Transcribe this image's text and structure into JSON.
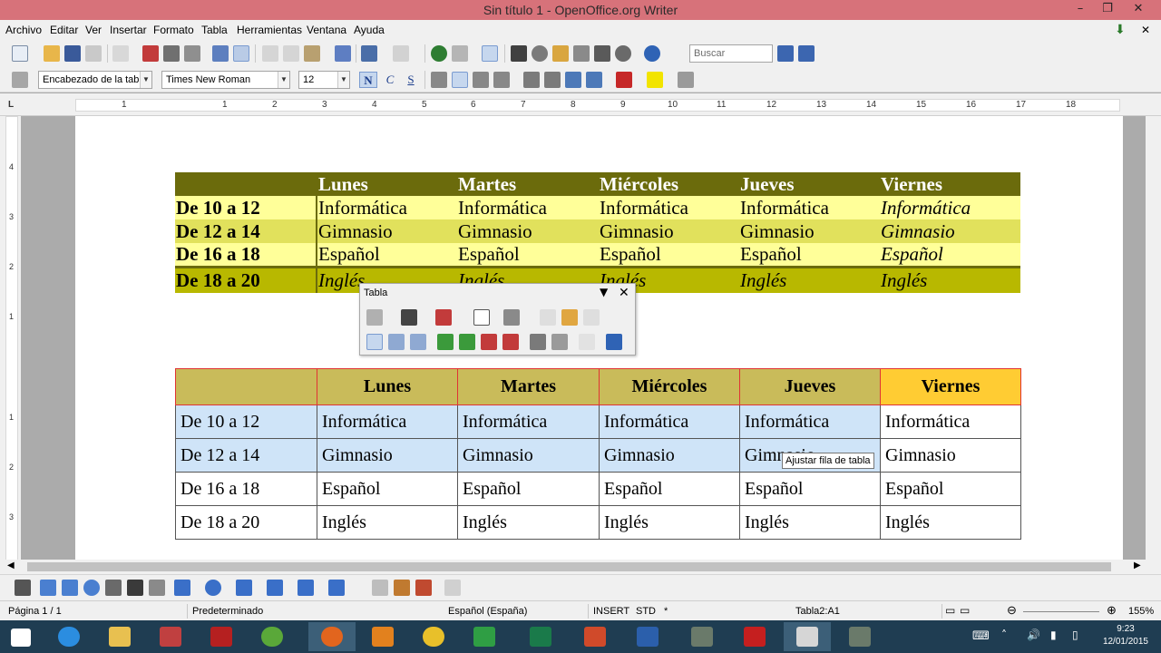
{
  "window": {
    "title": "Sin título 1 - OpenOffice.org Writer"
  },
  "menu": [
    "Archivo",
    "Editar",
    "Ver",
    "Insertar",
    "Formato",
    "Tabla",
    "Herramientas",
    "Ventana",
    "Ayuda"
  ],
  "toolbar": {
    "search_placeholder": "Buscar",
    "paragraph_style": "Encabezado de la tabl",
    "font_name": "Times New Roman",
    "font_size": "12",
    "bold_label": "N",
    "italic_label": "C",
    "underline_label": "S"
  },
  "ruler": {
    "h": [
      "1",
      "1",
      "2",
      "3",
      "4",
      "5",
      "6",
      "7",
      "8",
      "9",
      "10",
      "11",
      "12",
      "13",
      "14",
      "15",
      "16",
      "17",
      "18"
    ],
    "v": [
      "4",
      "3",
      "2",
      "1",
      "1",
      "2",
      "3"
    ]
  },
  "table1": {
    "header": [
      "",
      "Lunes",
      "Martes",
      "Miércoles",
      "Jueves",
      "Viernes"
    ],
    "rows": [
      [
        "De 10 a 12",
        "Informática",
        "Informática",
        "Informática",
        "Informática",
        "Informática"
      ],
      [
        "De 12 a 14",
        "Gimnasio",
        "Gimnasio",
        "Gimnasio",
        "Gimnasio",
        "Gimnasio"
      ],
      [
        "De 16 a 18",
        "Español",
        "Español",
        "Español",
        "Español",
        "Español"
      ],
      [
        "De 18 a 20",
        "Inglés",
        "Inglés",
        "Inglés",
        "Inglés",
        "Inglés"
      ]
    ]
  },
  "table2": {
    "header": [
      "",
      "Lunes",
      "Martes",
      "Miércoles",
      "Jueves",
      "Viernes"
    ],
    "rows": [
      [
        "De 10 a 12",
        "Informática",
        "Informática",
        "Informática",
        "Informática",
        "Informática"
      ],
      [
        "De 12 a 14",
        "Gimnasio",
        "Gimnasio",
        "Gimnasio",
        "Gimnasio",
        "Gimnasio"
      ],
      [
        "De 16 a 18",
        "Español",
        "Español",
        "Español",
        "Español",
        "Español"
      ],
      [
        "De 18 a 20",
        "Inglés",
        "Inglés",
        "Inglés",
        "Inglés",
        "Inglés"
      ]
    ]
  },
  "float_toolbar": {
    "title": "Tabla"
  },
  "tooltip": "Ajustar fila de tabla",
  "status": {
    "page": "Página 1 / 1",
    "style": "Predeterminado",
    "language": "Español (España)",
    "insert": "INSERT",
    "std": "STD",
    "modified": "*",
    "cell": "Tabla2:A1",
    "zoom": "155%"
  },
  "clock": {
    "time": "9:23",
    "date": "12/01/2015"
  },
  "colors": {
    "titlebar": "#d7727a",
    "t1_header": "#6b6b0c",
    "t1_light": "#ffff99",
    "t1_mid": "#e1e15c",
    "t2_header": "#c9bb5a",
    "t2_selected": "#cfe4f8",
    "taskbar": "#1f3d52"
  }
}
